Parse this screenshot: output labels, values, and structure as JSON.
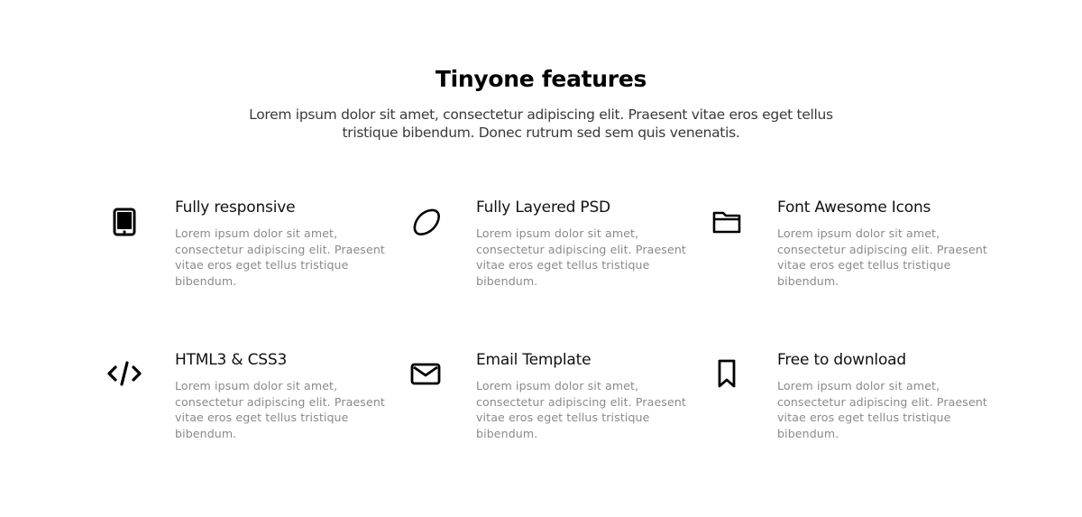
{
  "header": {
    "title": "Tinyone features",
    "subtitle": "Lorem ipsum dolor sit amet, consectetur adipiscing elit. Praesent vitae eros eget tellus tristique bibendum. Donec rutrum sed sem quis venenatis."
  },
  "features": [
    {
      "title": "Fully responsive",
      "icon": "tablet-icon",
      "description": "Lorem ipsum dolor sit amet, consectetur adipiscing elit. Praesent vitae eros eget tellus tristique bibendum."
    },
    {
      "title": "Fully Layered PSD",
      "icon": "lemon-icon",
      "description": "Lorem ipsum dolor sit amet, consectetur adipiscing elit. Praesent vitae eros eget tellus tristique bibendum."
    },
    {
      "title": "Font Awesome Icons",
      "icon": "folder-icon",
      "description": "Lorem ipsum dolor sit amet, consectetur adipiscing elit. Praesent vitae eros eget tellus tristique bibendum."
    },
    {
      "title": "HTML3 & CSS3",
      "icon": "code-icon",
      "description": "Lorem ipsum dolor sit amet, consectetur adipiscing elit. Praesent vitae eros eget tellus tristique bibendum."
    },
    {
      "title": "Email Template",
      "icon": "envelope-icon",
      "description": "Lorem ipsum dolor sit amet, consectetur adipiscing elit. Praesent vitae eros eget tellus tristique bibendum."
    },
    {
      "title": "Free to download",
      "icon": "bookmark-icon",
      "description": "Lorem ipsum dolor sit amet, consectetur adipiscing elit. Praesent vitae eros eget tellus tristique bibendum."
    }
  ]
}
